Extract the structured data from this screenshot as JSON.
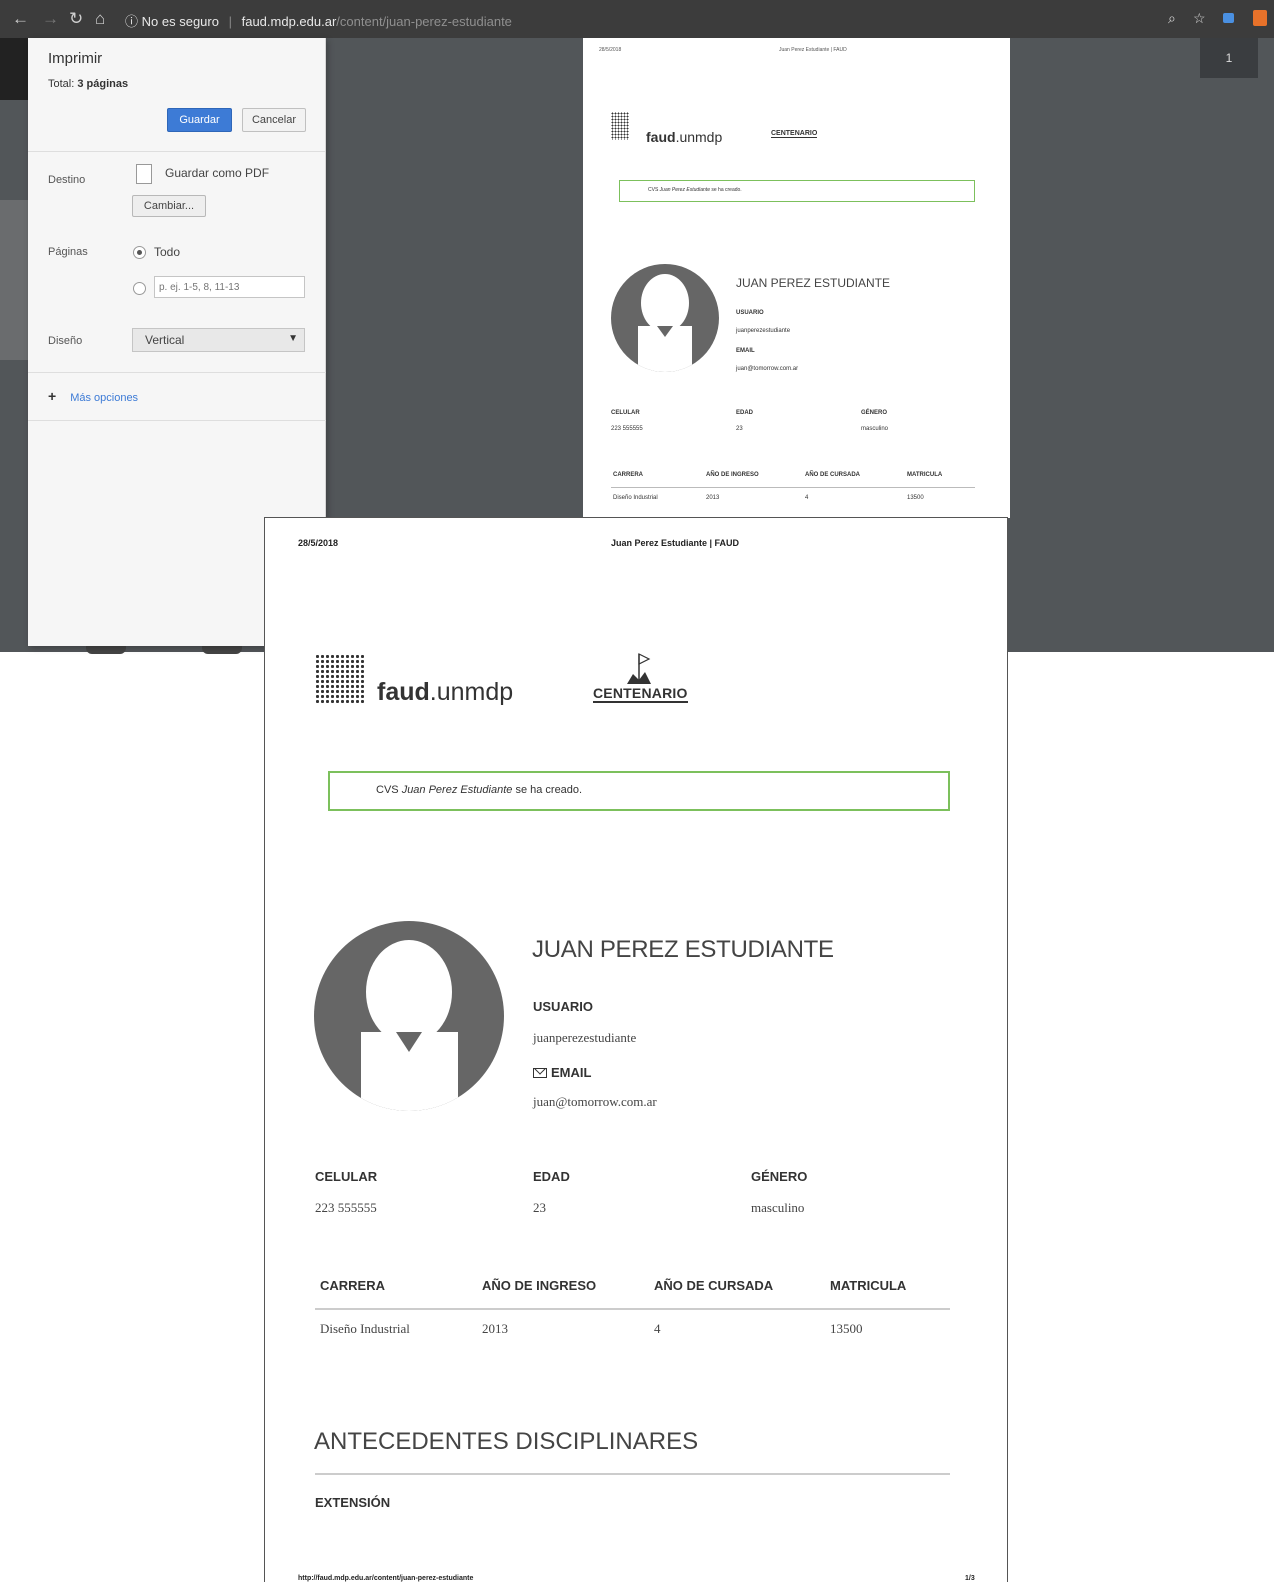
{
  "browser": {
    "security_label": "No es seguro",
    "url_host": "faud.mdp.edu.ar",
    "url_path": "/content/juan-perez-estudiante",
    "page_indicator": "1"
  },
  "print_dialog": {
    "title": "Imprimir",
    "total_label": "Total:",
    "total_value": "3 páginas",
    "save_label": "Guardar",
    "cancel_label": "Cancelar",
    "destination_label": "Destino",
    "destination_value": "Guardar como PDF",
    "change_label": "Cambiar...",
    "pages_label": "Páginas",
    "pages_all": "Todo",
    "pages_range_placeholder": "p. ej. 1-5, 8, 11-13",
    "layout_label": "Diseño",
    "layout_value": "Vertical",
    "more_options": "Más opciones"
  },
  "preview": {
    "date": "28/5/2018",
    "header_title": "Juan Perez Estudiante | FAUD",
    "logo_bold": "faud",
    "logo_light": ".unmdp",
    "centenario": "CENTENARIO",
    "notice_prefix": "CVS",
    "notice_name": "Juan Perez Estudiante",
    "notice_suffix": "se ha creado.",
    "full_name": "JUAN PEREZ ESTUDIANTE",
    "usuario_label": "USUARIO",
    "usuario_value": "juanperezestudiante",
    "email_label": "EMAIL",
    "email_value": "juan@tomorrow.com.ar",
    "celular_label": "CELULAR",
    "celular_value": "223 555555",
    "edad_label": "EDAD",
    "edad_value": "23",
    "genero_label": "GÉNERO",
    "genero_value": "masculino",
    "table_headers": [
      "CARRERA",
      "AÑO DE INGRESO",
      "AÑO DE CURSADA",
      "MATRICULA"
    ],
    "table_row": [
      "Diseño Industrial",
      "2013",
      "4",
      "13500"
    ],
    "section_title": "ANTECEDENTES DISCIPLINARES",
    "subsection": "EXTENSIÓN",
    "footer_url": "http://faud.mdp.edu.ar/content/juan-perez-estudiante",
    "footer_page": "1/3"
  }
}
